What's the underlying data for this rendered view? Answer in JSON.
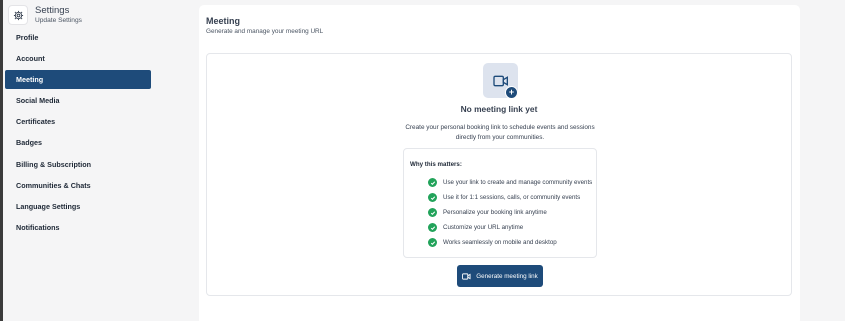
{
  "sidebar": {
    "title": "Settings",
    "subtitle": "Update Settings",
    "header_icon": "gear-icon",
    "items": [
      {
        "label": "Profile",
        "active": false
      },
      {
        "label": "Account",
        "active": false
      },
      {
        "label": "Meeting",
        "active": true
      },
      {
        "label": "Social Media",
        "active": false
      },
      {
        "label": "Certificates",
        "active": false
      },
      {
        "label": "Badges",
        "active": false
      },
      {
        "label": "Billing & Subscription",
        "active": false
      },
      {
        "label": "Communities & Chats",
        "active": false
      },
      {
        "label": "Language Settings",
        "active": false
      },
      {
        "label": "Notifications",
        "active": false
      }
    ]
  },
  "main": {
    "title": "Meeting",
    "subtitle": "Generate and manage your meeting URL",
    "empty_state": {
      "icon": "video-camera-icon",
      "badge_icon": "plus-icon",
      "badge_text": "+",
      "title": "No meeting link yet",
      "description": "Create your personal booking link to schedule events and sessions directly from your communities."
    },
    "why": {
      "title": "Why this matters:",
      "items": [
        "Use your link to create and manage community events",
        "Use it for 1:1 sessions, calls, or community events",
        "Personalize your booking link anytime",
        "Customize your URL anytime",
        "Works seamlessly on mobile and desktop"
      ]
    },
    "generate_button": {
      "label": "Generate meeting link",
      "icon": "video-camera-icon"
    }
  },
  "colors": {
    "accent": "#1e4b7a",
    "success": "#22a35a",
    "background": "#f5f5f6"
  }
}
